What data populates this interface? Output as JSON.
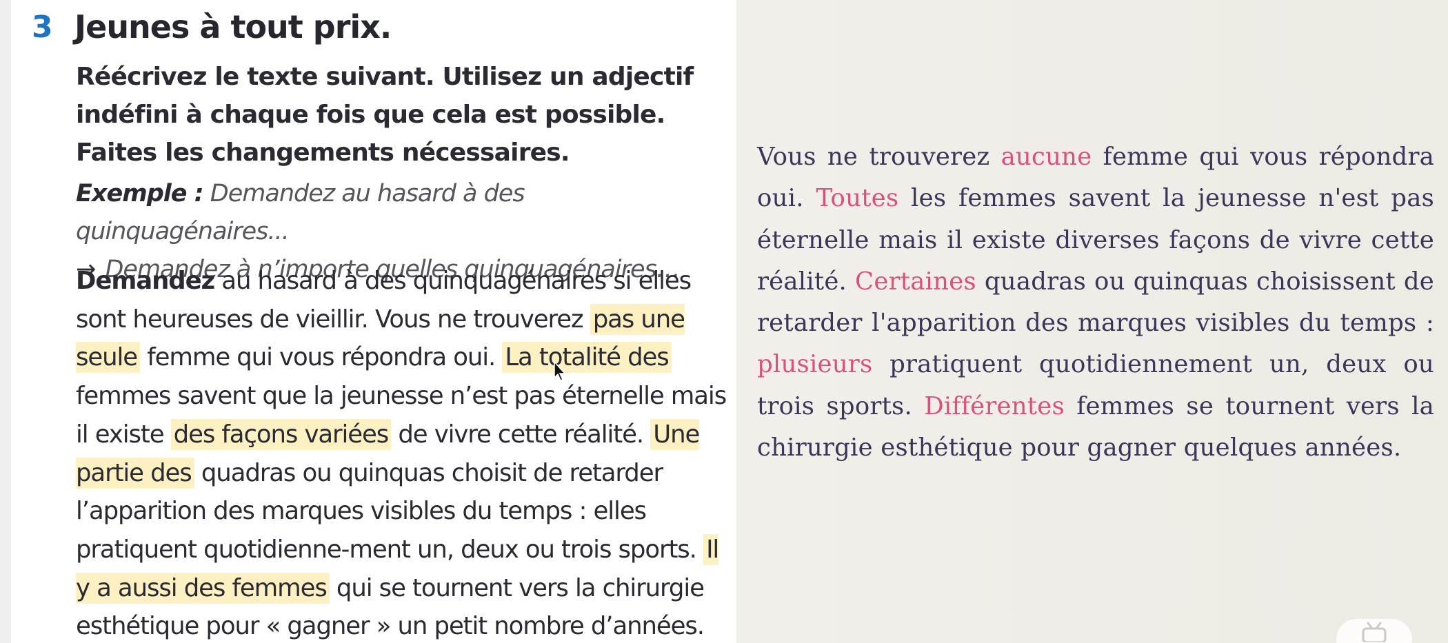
{
  "exercise": {
    "number": "3",
    "title": "Jeunes à tout prix.",
    "instructions": {
      "line1": "Réécrivez le texte suivant. Utilisez un adjectif",
      "line2": "indéfini à chaque fois que cela est possible.",
      "line3": "Faites les changements nécessaires."
    },
    "example": {
      "label": "Exemple :",
      "sentence": " Demandez au hasard à des quinquagénaires...",
      "arrow": "→",
      "answer": "Demandez à n’importe quelles quinquagénaires…"
    },
    "text": {
      "first_word": "Demandez",
      "seg1": " au hasard à des quinquagénaires si elles sont heureuses de vieillir. Vous ne trouverez ",
      "hl1": "pas une seule",
      "seg2": " femme qui vous répondra oui. ",
      "hl2": "La totalité des",
      "seg3": " femmes savent que la jeunesse n’est pas éternelle mais il existe ",
      "hl3": "des façons variées",
      "seg4": " de vivre cette réalité. ",
      "hl4": "Une partie des",
      "seg5": " quadras ou quinquas choisit de retarder l’apparition des marques visibles du temps : elles pratiquent quotidienne-ment un, deux ou trois sports. ",
      "hl5": "Il y a aussi des femmes",
      "seg6": " qui se tournent vers la chirurgie esthétique pour « gagner » un petit nombre d’années."
    }
  },
  "answer": {
    "p1": "Vous ne trouverez ",
    "w1": "aucune",
    "p2": " femme qui vous répondra oui. ",
    "w2": "Toutes",
    "p3": " les femmes savent la jeunesse n'est pas éternelle mais il existe diverses  façons de vivre cette réalité. ",
    "w3": "Certaines",
    "p4": " quadras ou quinquas choisissent de retarder l'apparition des marques visibles du temps : ",
    "w4": "plusieurs",
    "p5": " pratiquent quotidiennement un, deux ou trois sports. ",
    "w5": "Différentes",
    "p6": " femmes se tournent vers la chirurgie esthétique pour gagner quelques années."
  },
  "colors": {
    "exercise_number": "#1f73c5",
    "highlight": "#fdf0c2",
    "answer_text": "#3d3558",
    "answer_keyword": "#d9527e"
  },
  "icons": {
    "cursor": "mouse-pointer-icon",
    "corner": "bilibili-tv-icon"
  }
}
